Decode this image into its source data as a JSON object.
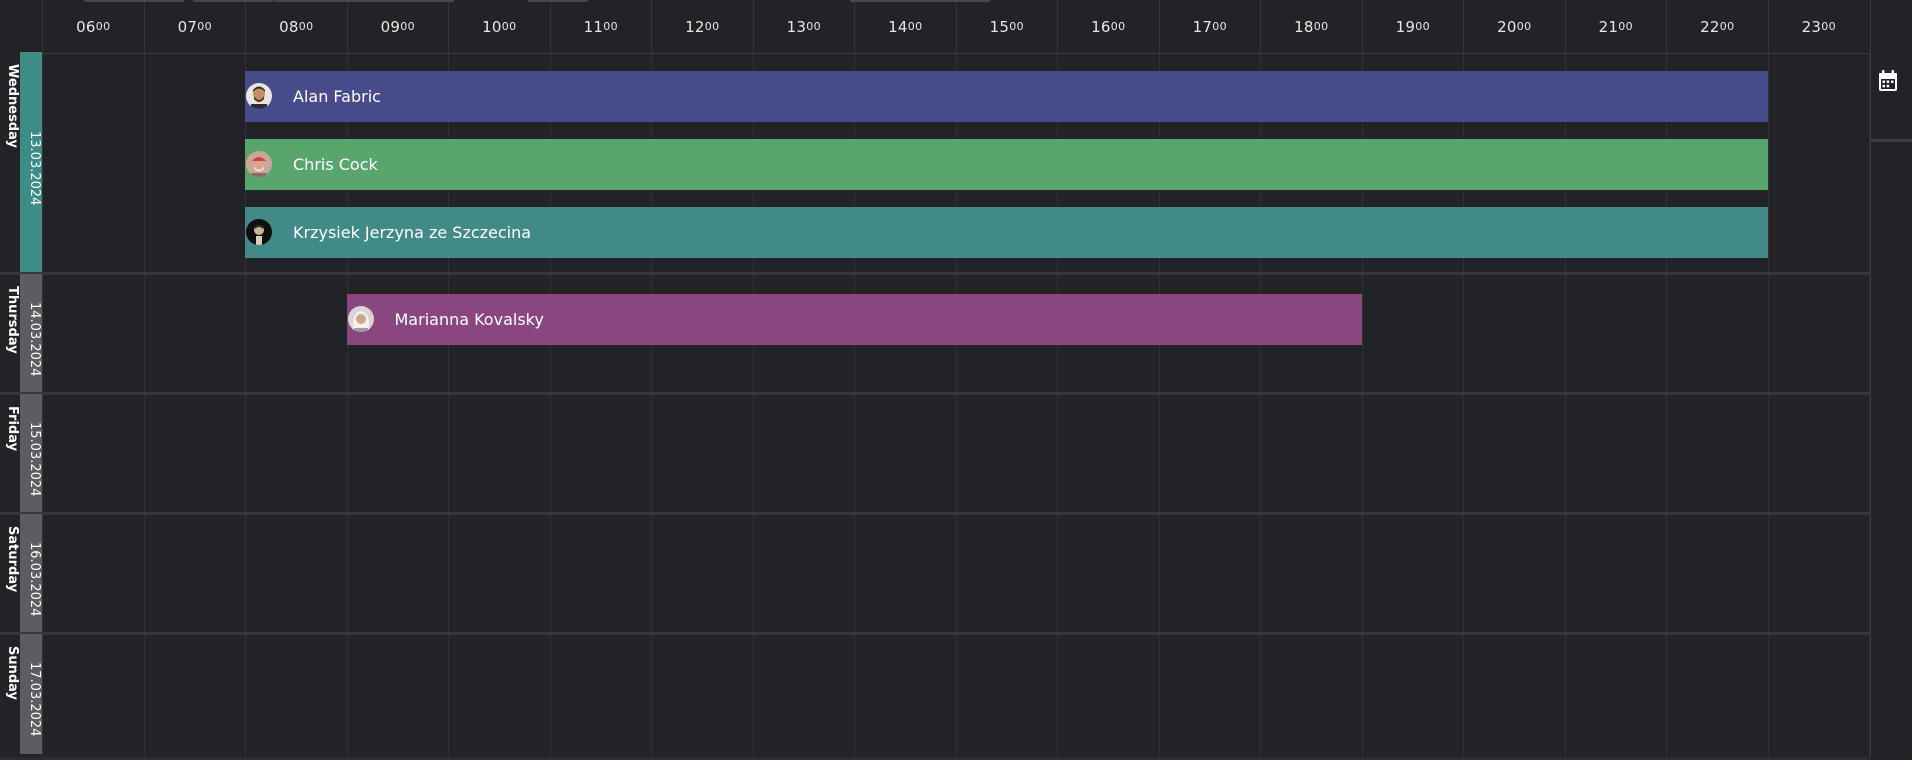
{
  "header": {
    "hours": [
      {
        "h": "06",
        "m": "00"
      },
      {
        "h": "07",
        "m": "00"
      },
      {
        "h": "08",
        "m": "00"
      },
      {
        "h": "09",
        "m": "00"
      },
      {
        "h": "10",
        "m": "00"
      },
      {
        "h": "11",
        "m": "00"
      },
      {
        "h": "12",
        "m": "00"
      },
      {
        "h": "13",
        "m": "00"
      },
      {
        "h": "14",
        "m": "00"
      },
      {
        "h": "15",
        "m": "00"
      },
      {
        "h": "16",
        "m": "00"
      },
      {
        "h": "17",
        "m": "00"
      },
      {
        "h": "18",
        "m": "00"
      },
      {
        "h": "19",
        "m": "00"
      },
      {
        "h": "20",
        "m": "00"
      },
      {
        "h": "21",
        "m": "00"
      },
      {
        "h": "22",
        "m": "00"
      },
      {
        "h": "23",
        "m": "00"
      }
    ]
  },
  "days": [
    {
      "name": "Wednesday",
      "date": "13.03.2024",
      "color": "#3d8c86",
      "active": true
    },
    {
      "name": "Thursday",
      "date": "14.03.2024",
      "color": "#5c5d60",
      "active": false
    },
    {
      "name": "Friday",
      "date": "15.03.2024",
      "color": "#5c5d60",
      "active": false
    },
    {
      "name": "Saturday",
      "date": "16.03.2024",
      "color": "#5c5d60",
      "active": false
    },
    {
      "name": "Sunday",
      "date": "17.03.2024",
      "color": "#5c5d60",
      "active": false
    }
  ],
  "shifts": [
    {
      "name": "Alan Fabric",
      "day": 0,
      "start": 8,
      "end": 23,
      "color": "#464b8a",
      "avatar": "bearded-man-avatar"
    },
    {
      "name": "Chris Cock",
      "day": 0,
      "start": 8,
      "end": 23,
      "color": "#58a56d",
      "avatar": "red-cap-man-avatar"
    },
    {
      "name": "Krzysiek Jerzyna ze Szczecina",
      "day": 0,
      "start": 8,
      "end": 23,
      "color": "#428a88",
      "avatar": "dark-portrait-avatar"
    },
    {
      "name": "Marianna Kovalsky",
      "day": 1,
      "start": 9,
      "end": 19,
      "color": "#8a4681",
      "avatar": "white-hair-woman-avatar"
    }
  ],
  "side_panel": {
    "icon": "calendar-icon"
  }
}
